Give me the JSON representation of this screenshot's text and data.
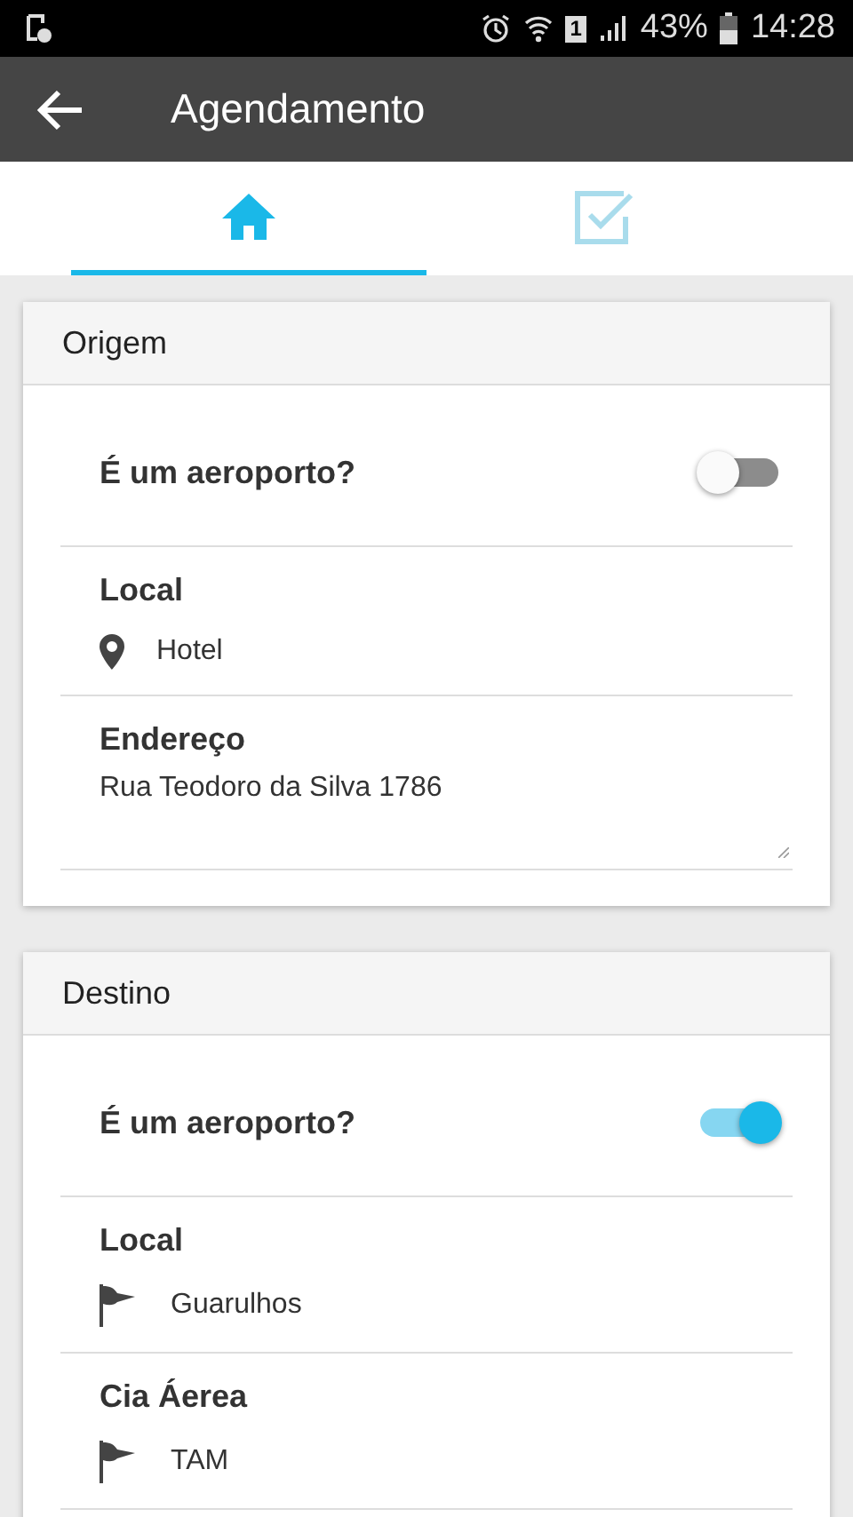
{
  "status_bar": {
    "sim": "1",
    "battery": "43%",
    "time": "14:28"
  },
  "app_bar": {
    "title": "Agendamento"
  },
  "tabs": [
    {
      "kind": "home",
      "selected": true
    },
    {
      "kind": "check",
      "selected": false
    }
  ],
  "sections": [
    {
      "title": "Origem",
      "fields": [
        {
          "kind": "toggle",
          "label": "É um aeroporto?",
          "on": false
        },
        {
          "kind": "pin",
          "label": "Local",
          "value": "Hotel"
        },
        {
          "kind": "text",
          "label": "Endereço",
          "value": "Rua Teodoro da Silva 1786"
        }
      ]
    },
    {
      "title": "Destino",
      "fields": [
        {
          "kind": "toggle",
          "label": "É um aeroporto?",
          "on": true
        },
        {
          "kind": "flag",
          "label": "Local",
          "value": "Guarulhos"
        },
        {
          "kind": "flag",
          "label": "Cia Áerea",
          "value": "TAM"
        }
      ]
    }
  ]
}
